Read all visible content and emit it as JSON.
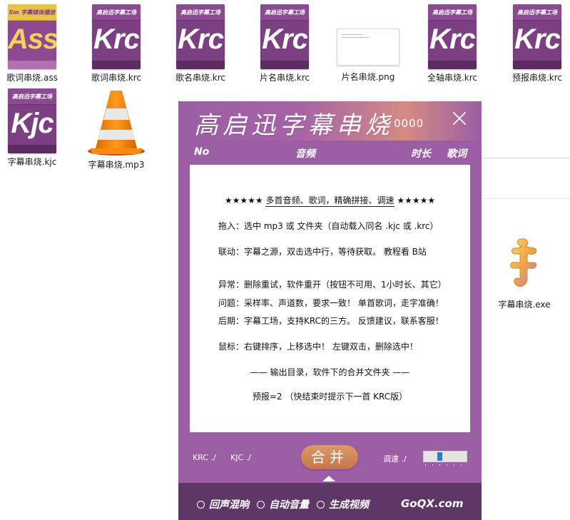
{
  "desktop": {
    "files": [
      {
        "name": "歌词串烧.ass",
        "badge": "Sm 字幕媒体播放",
        "big": "Ass",
        "kind": "ass"
      },
      {
        "name": "歌词串烧.krc",
        "badge": "高启迅字幕工场",
        "big": "Krc",
        "kind": "krc"
      },
      {
        "name": "歌名串烧.krc",
        "badge": "高启迅字幕工场",
        "big": "Krc",
        "kind": "krc"
      },
      {
        "name": "片名串烧.krc",
        "badge": "高启迅字幕工场",
        "big": "Krc",
        "kind": "krc"
      },
      {
        "name": "片名串烧.png",
        "kind": "png"
      },
      {
        "name": "全轴串烧.krc",
        "badge": "高启迅字幕工场",
        "big": "Krc",
        "kind": "krc"
      },
      {
        "name": "预报串烧.krc",
        "badge": "高启迅字幕工场",
        "big": "Krc",
        "kind": "krc"
      },
      {
        "name": "字幕串烧.kjc",
        "badge": "高启迅字幕工场",
        "big": "Kjc",
        "kind": "kjc"
      },
      {
        "name": "字幕串烧.mp3",
        "icon": "vlc-cone-icon",
        "kind": "mp3"
      },
      {
        "name": "字幕串烧.exe",
        "icon": "app-exe-icon",
        "kind": "exe"
      }
    ]
  },
  "app": {
    "title": "高启迅字幕串烧",
    "counter": "0000",
    "columns": {
      "no": "No",
      "audio": "音频",
      "duration": "时长",
      "lyrics": "歌词"
    },
    "info": {
      "headline_stars_left": "★★★★★",
      "headline": "多首音频、歌词，精确拼接、调速",
      "headline_stars_right": "★★★★★",
      "line1": "拖入：选中 mp3 或 文件夹（自动载入同名 .kjc 或 .krc）",
      "line2": "联动：字幕之源，双击选中行，等待获取。    教程看 B站",
      "line3": "异常：删除重试，软件重开（按钮不可用、1小时长、其它）",
      "line4": "问题：采样率、声道数，要求一致！  单首歌词，走字准确！",
      "line5": "后期：字幕工场，支持KRC的三方。  反馈建议，联系客服！",
      "line6": "鼠标：右键排序，上移选中！          左键双击，删除选中！",
      "line7": "——    输出目录，软件下的合并文件夹    ——",
      "line8": "预报=2 （快结束时提示下一首 KRC版）"
    },
    "controls": {
      "krc_label": "KRC ./",
      "kjc_label": "KJC ./",
      "merge_label": "合并",
      "speed_label": "调速 ./",
      "speed_value": 0.35
    },
    "footer": {
      "opt1": "回声混响",
      "opt2": "自动音量",
      "opt3": "生成视频",
      "brand": "GoQX.com"
    }
  },
  "colors": {
    "app_purple": "#9b5ea5",
    "footer_purple": "#5e3767",
    "file_purple": "#7b3f82",
    "merge_orange": "#c7744a",
    "slider_blue": "#1f7fd6"
  }
}
